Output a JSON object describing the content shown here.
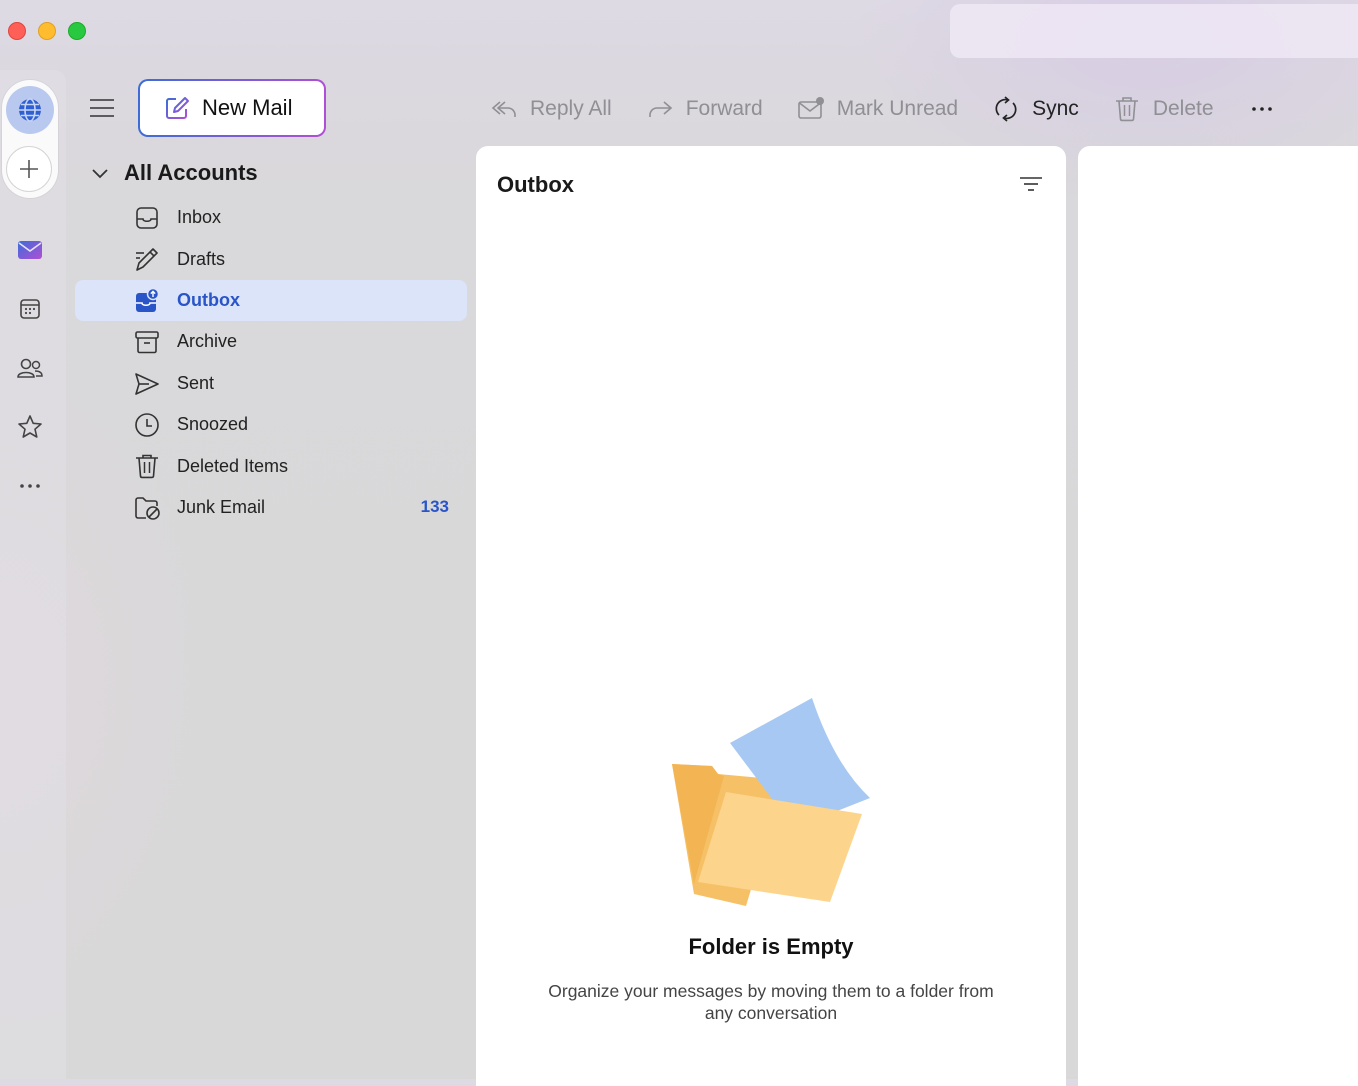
{
  "window": {
    "controls": [
      "close",
      "minimize",
      "zoom"
    ]
  },
  "rail": {
    "items": [
      {
        "icon": "globe-icon",
        "active": true
      },
      {
        "icon": "plus-icon"
      },
      {
        "icon": "mail-icon"
      },
      {
        "icon": "calendar-icon"
      },
      {
        "icon": "people-icon"
      },
      {
        "icon": "star-icon"
      },
      {
        "icon": "more-horizontal-icon"
      }
    ]
  },
  "compose": {
    "label": "New Mail",
    "icon": "compose-icon"
  },
  "accounts": {
    "label": "All Accounts"
  },
  "folders": [
    {
      "label": "Inbox",
      "icon": "inbox-icon"
    },
    {
      "label": "Drafts",
      "icon": "drafts-pencil-icon"
    },
    {
      "label": "Outbox",
      "icon": "outbox-icon",
      "active": true
    },
    {
      "label": "Archive",
      "icon": "archive-icon"
    },
    {
      "label": "Sent",
      "icon": "send-icon"
    },
    {
      "label": "Snoozed",
      "icon": "clock-icon"
    },
    {
      "label": "Deleted Items",
      "icon": "trash-icon"
    },
    {
      "label": "Junk Email",
      "icon": "junk-folder-icon",
      "count": "133"
    }
  ],
  "toolbar": {
    "reply_all": "Reply All",
    "forward": "Forward",
    "mark_unread": "Mark Unread",
    "sync": "Sync",
    "delete": "Delete"
  },
  "message_list": {
    "title": "Outbox",
    "empty_title": "Folder is Empty",
    "empty_desc": "Organize your messages by moving them to a folder from any conversation"
  },
  "colors": {
    "accent": "#2a55c8",
    "active_folder_bg": "#dbe4f8",
    "compose_gradient": [
      "#3d6cd8",
      "#b04fd6"
    ]
  }
}
